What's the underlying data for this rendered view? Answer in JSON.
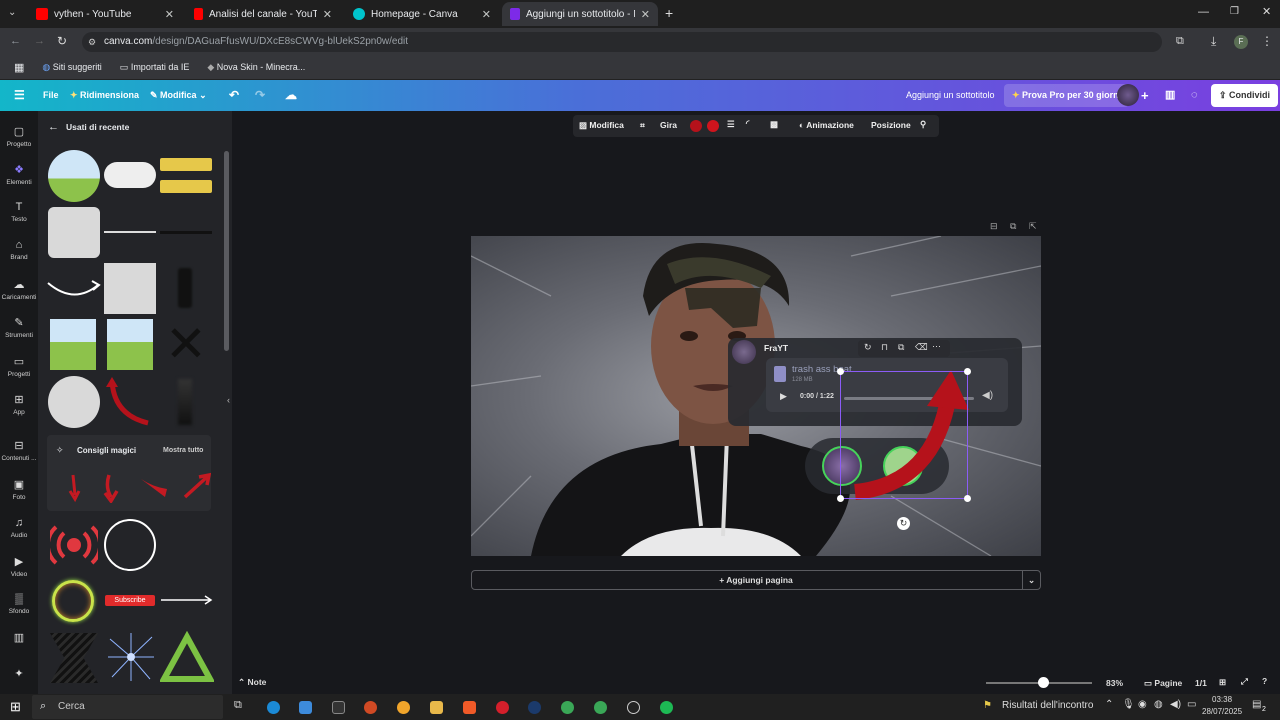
{
  "browser": {
    "tabs": [
      {
        "title": "vythen - YouTube",
        "color": "#ff0000"
      },
      {
        "title": "Analisi del canale - YouTube Stu",
        "color": "#ff0000"
      },
      {
        "title": "Homepage - Canva",
        "color": "#00c4cc"
      },
      {
        "title": "Aggiungi un sottotitolo - Minia",
        "color": "#7d2ae8"
      }
    ],
    "url_host": "canva.com",
    "url_path": "/design/DAGuaFfusWU/DXcE8sCWVg-blUekS2pn0w/edit",
    "bookmarks": [
      "Siti suggeriti",
      "Importati da IE",
      "Nova Skin - Minecra..."
    ],
    "profile_initial": "F"
  },
  "canva": {
    "menu": {
      "file": "File",
      "resize": "Ridimensiona",
      "edit": "Modifica"
    },
    "design_title": "Aggiungi un sottotitolo",
    "promo": "Prova Pro per 30 giorni",
    "share": "Condividi",
    "rail": [
      "Progetto",
      "Elementi",
      "Testo",
      "Brand",
      "Caricamenti",
      "Strumenti",
      "Progetti",
      "App",
      "Contenuti ...",
      "Foto",
      "Audio",
      "Video",
      "Sfondo"
    ],
    "panel": {
      "back_title": "Usati di recente",
      "magic_title": "Consigli magici",
      "magic_more": "Mostra tutto",
      "subscribe": "Subscribe"
    },
    "context_toolbar": {
      "edit": "Modifica",
      "flip": "Gira",
      "animate": "Animazione",
      "position": "Posizione"
    },
    "card": {
      "author": "FraYT",
      "file_name": "trash ass beat",
      "file_size": "128 MB",
      "time": "0:00 / 1:22"
    },
    "add_page": "+ Aggiungi pagina",
    "bottom": {
      "notes": "Note",
      "zoom": "83%",
      "pages_label": "Pagine",
      "pages": "1/1"
    },
    "colors": {
      "accent_start": "#13b6c9",
      "accent_end": "#7a3fe0",
      "arrow_red": "#b5121b"
    }
  },
  "taskbar": {
    "search": "Cerca",
    "notice": "Risultati dell'incontro",
    "time": "03:38",
    "date": "28/07/2025",
    "notifications": "2"
  }
}
